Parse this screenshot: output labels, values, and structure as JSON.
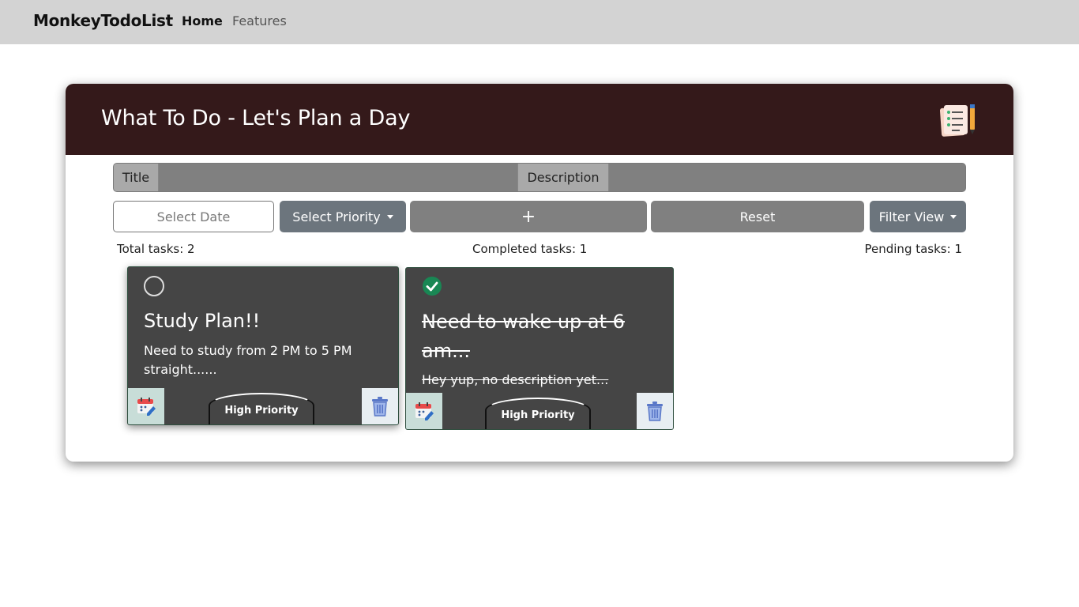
{
  "navbar": {
    "brand": "MonkeyTodoList",
    "links": [
      {
        "label": "Home",
        "active": true
      },
      {
        "label": "Features",
        "active": false
      }
    ]
  },
  "header": {
    "title": "What To Do - Let's Plan a Day",
    "icon": "checklist-notepad-icon"
  },
  "form": {
    "title_label": "Title",
    "title_value": "",
    "description_label": "Description",
    "description_value": "",
    "date_placeholder": "Select Date",
    "priority_label": "Select Priority",
    "add_label": "+",
    "reset_label": "Reset",
    "filter_label": "Filter View"
  },
  "stats": {
    "total": "Total tasks: 2",
    "completed": "Completed tasks: 1",
    "pending": "Pending tasks: 1"
  },
  "tasks": [
    {
      "title": "Study Plan!!",
      "description": "Need to study from 2 PM to 5 PM straight......",
      "completed": false,
      "priority": "High Priority"
    },
    {
      "title": "Need to wake up at 6 am...",
      "description": "Hey yup, no description yet...",
      "completed": true,
      "priority": "High Priority"
    }
  ],
  "colors": {
    "navbar_bg": "#d3d3d3",
    "header_bg": "#34191a",
    "card_bg": "#454545",
    "check_done": "#198754",
    "button_gray": "#6c757d"
  }
}
